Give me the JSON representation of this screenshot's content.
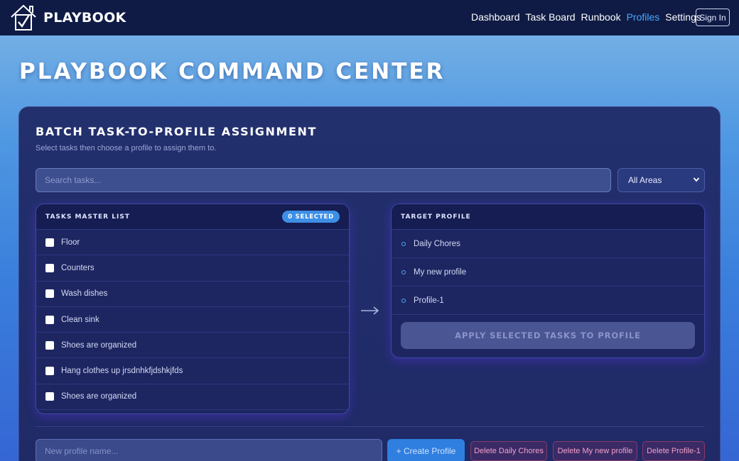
{
  "nav": {
    "brand": "PLAYBOOK",
    "links": [
      {
        "label": "Dashboard",
        "active": false
      },
      {
        "label": "Task Board",
        "active": false
      },
      {
        "label": "Runbook",
        "active": false
      },
      {
        "label": "Profiles",
        "active": true
      },
      {
        "label": "Settings",
        "active": false
      }
    ],
    "signin_label": "Sign In"
  },
  "page": {
    "title": "PLAYBOOK COMMAND CENTER"
  },
  "batch": {
    "title": "BATCH TASK-TO-PROFILE ASSIGNMENT",
    "subtitle": "Select tasks then choose a profile to assign them to.",
    "search_placeholder": "Search tasks...",
    "area_filter": "All Areas",
    "tasks_header": "TASKS MASTER LIST",
    "selected_badge": "0 SELECTED",
    "tasks": [
      {
        "label": "Floor",
        "checked": false
      },
      {
        "label": "Counters",
        "checked": false
      },
      {
        "label": "Wash dishes",
        "checked": false
      },
      {
        "label": "Clean sink",
        "checked": false
      },
      {
        "label": "Shoes are organized",
        "checked": false
      },
      {
        "label": "Hang clothes up jrsdnhkfjdshkjfds",
        "checked": false
      },
      {
        "label": "Shoes are organized",
        "checked": false
      }
    ],
    "profile_header": "TARGET PROFILE",
    "profiles": [
      {
        "label": "Daily Chores"
      },
      {
        "label": "My new profile"
      },
      {
        "label": "Profile-1"
      }
    ],
    "apply_label": "APPLY SELECTED TASKS TO PROFILE"
  },
  "manage": {
    "new_profile_placeholder": "New profile name...",
    "create_label": "+ Create Profile",
    "delete_buttons": [
      {
        "label": "Delete Daily Chores"
      },
      {
        "label": "Delete My new profile"
      },
      {
        "label": "Delete Profile-1"
      }
    ]
  },
  "colors": {
    "navbar": "#0f1b45",
    "accent": "#4aa8ff",
    "card": "#23306e",
    "danger_text": "#f0a0c8"
  }
}
